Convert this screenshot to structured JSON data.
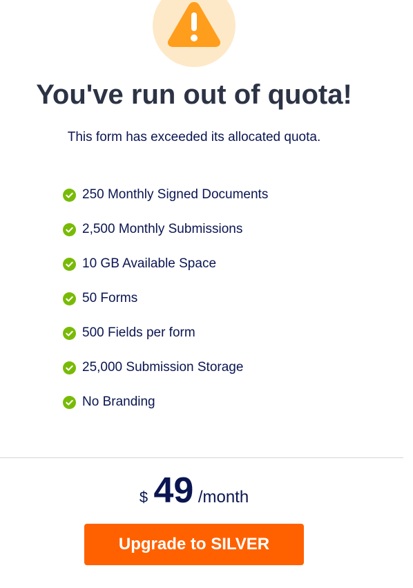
{
  "header": {
    "icon": "warning-triangle-icon",
    "icon_color": "#ff9d1c",
    "icon_bg_color": "#fde9c8",
    "title": "You've run out of quota!",
    "subtitle": "This form has exceeded its allocated quota."
  },
  "features": {
    "icon": "check-circle-icon",
    "icon_color": "#78bb07",
    "items": [
      {
        "label": "250 Monthly Signed Documents"
      },
      {
        "label": "2,500 Monthly Submissions"
      },
      {
        "label": "10 GB Available Space"
      },
      {
        "label": "50 Forms"
      },
      {
        "label": "500 Fields per form"
      },
      {
        "label": "25,000 Submission Storage"
      },
      {
        "label": "No Branding"
      }
    ]
  },
  "pricing": {
    "currency": "$",
    "amount": "49",
    "period": "/month"
  },
  "cta": {
    "label": "Upgrade to SILVER",
    "color": "#ff6100"
  }
}
